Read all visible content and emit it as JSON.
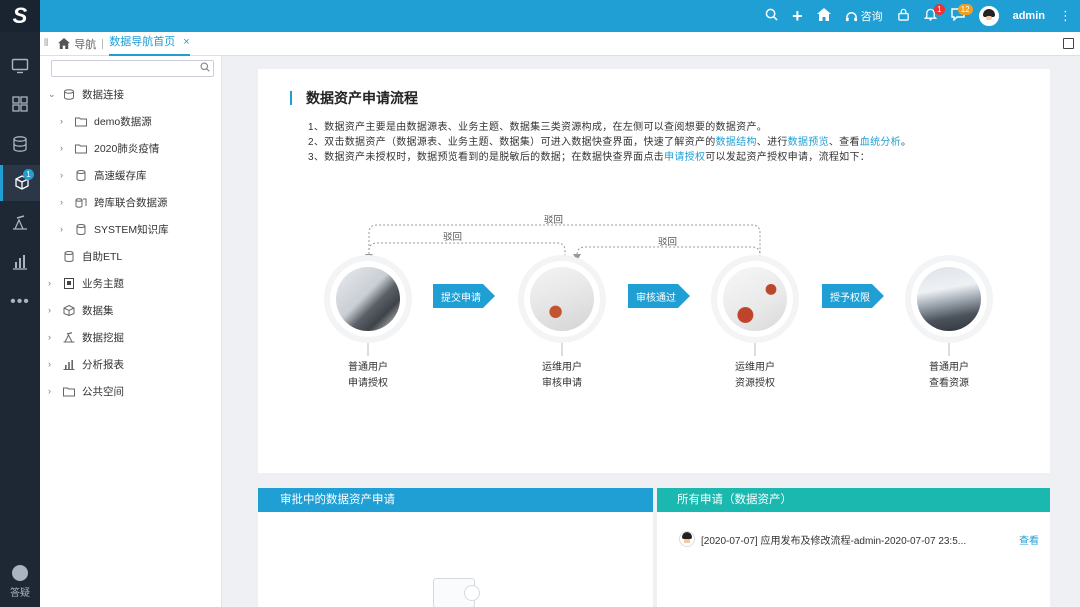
{
  "topbar": {
    "consult_label": "咨询",
    "notify_badge": "1",
    "message_badge": "12",
    "user_name": "admin"
  },
  "rail": {
    "badge": "1",
    "help_label": "答疑"
  },
  "tabs": {
    "home_label": "导航",
    "active_label": "数据导航首页",
    "close": "×"
  },
  "tree": [
    {
      "label": "数据连接",
      "level": 0,
      "expanded": true
    },
    {
      "label": "demo数据源",
      "level": 1
    },
    {
      "label": "2020肺炎疫情",
      "level": 1
    },
    {
      "label": "高速缓存库",
      "level": 1
    },
    {
      "label": "跨库联合数据源",
      "level": 1
    },
    {
      "label": "SYSTEM知识库",
      "level": 1
    },
    {
      "label": "自助ETL",
      "level": 0,
      "leaf": true
    },
    {
      "label": "业务主题",
      "level": 0
    },
    {
      "label": "数据集",
      "level": 0
    },
    {
      "label": "数据挖掘",
      "level": 0
    },
    {
      "label": "分析报表",
      "level": 0
    },
    {
      "label": "公共空间",
      "level": 0
    }
  ],
  "flow": {
    "title": "数据资产申请流程",
    "line1": "1、数据资产主要是由数据源表、业务主题、数据集三类资源构成，在左侧可以查阅想要的数据资产。",
    "line2_a": "2、双击数据资产（数据源表、业务主题、数据集）可进入数据快查界面，快速了解资产的",
    "line2_link1": "数据结构",
    "line2_b": "、进行",
    "line2_link2": "数据预览",
    "line2_c": "、查看",
    "line2_link3": "血统分析",
    "line2_d": "。",
    "line3_a": "3、数据资产未授权时，数据预览看到的是脱敏后的数据；在数据快查界面点击",
    "line3_link": "申请授权",
    "line3_b": "可以发起资产授权申请，流程如下：",
    "reject": "驳回",
    "actions": [
      "提交申请",
      "审核通过",
      "授予权限"
    ],
    "steps": [
      {
        "role": "普通用户",
        "action": "申请授权"
      },
      {
        "role": "运维用户",
        "action": "审核申请"
      },
      {
        "role": "运维用户",
        "action": "资源授权"
      },
      {
        "role": "普通用户",
        "action": "查看资源"
      }
    ]
  },
  "pending": {
    "title": "审批中的数据资产申请"
  },
  "all_requests": {
    "title": "所有申请（数据资产）",
    "item_text": "[2020-07-07]  应用发布及修改流程-admin-2020-07-07 23:5...",
    "view_label": "查看"
  }
}
